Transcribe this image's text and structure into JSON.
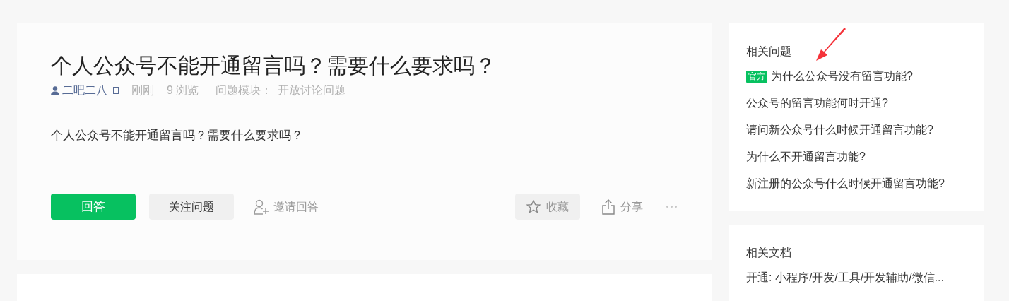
{
  "question": {
    "title": "个人公众号不能开通留言吗？需要什么要求吗？",
    "author": "二吧二八",
    "time": "刚刚",
    "views": "9 浏览",
    "module_label": "问题模块：",
    "module": "开放讨论问题",
    "body": "个人公众号不能开通留言吗？需要什么要求吗？",
    "actions": [
      {
        "kind": "primary",
        "label": "回答"
      },
      {
        "kind": "secondary",
        "label": "关注问题"
      },
      {
        "kind": "invite",
        "label": "邀请回答"
      }
    ],
    "right_actions": [
      {
        "kind": "star",
        "label": "收藏"
      },
      {
        "kind": "share",
        "label": "分享"
      },
      {
        "kind": "more"
      }
    ]
  },
  "related_questions": {
    "title": "相关问题",
    "items": [
      {
        "badge": "官方",
        "text": "为什么公众号没有留言功能?"
      },
      {
        "text": "公众号的留言功能何时开通?"
      },
      {
        "text": "请问新公众号什么时候开通留言功能?"
      },
      {
        "text": "为什么不开通留言功能?"
      },
      {
        "text": "新注册的公众号什么时候开通留言功能?"
      }
    ]
  },
  "related_docs": {
    "title": "相关文档",
    "items": [
      {
        "text": "开通: 小程序/开发/工具/开发辅助/微信..."
      }
    ]
  }
}
